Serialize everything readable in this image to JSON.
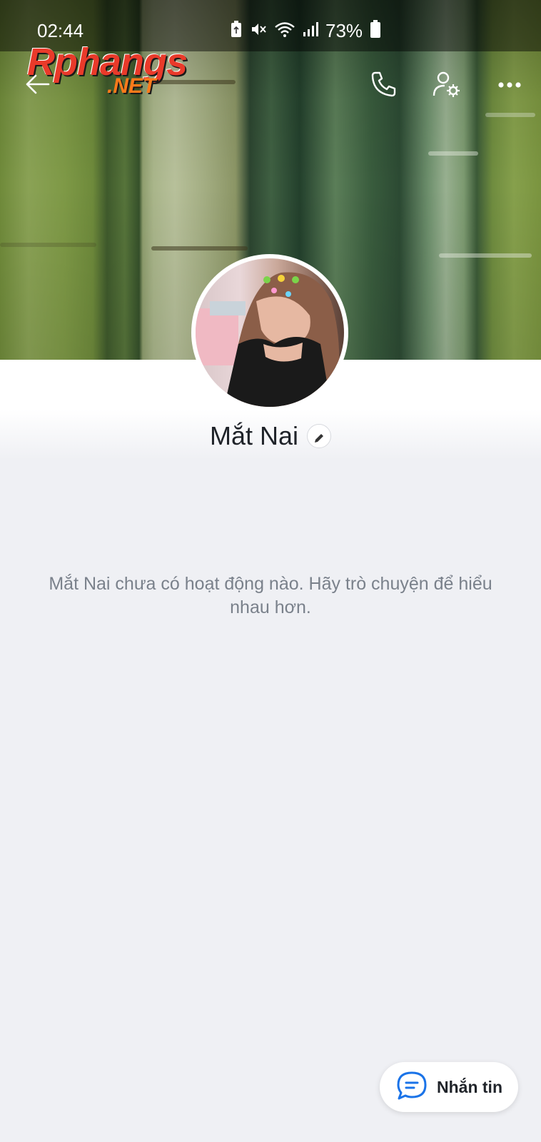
{
  "status_bar": {
    "time": "02:44",
    "battery_percent": "73%",
    "icons": [
      "battery-saver-icon",
      "mute-icon",
      "wifi-icon",
      "signal-icon",
      "battery-icon"
    ]
  },
  "watermark": {
    "line1": "Rphangs",
    "line2": ".NET"
  },
  "header": {
    "icons": [
      "back-arrow-icon",
      "phone-icon",
      "user-settings-icon",
      "more-icon"
    ]
  },
  "profile": {
    "name": "Mắt Nai",
    "empty_message": "Mắt Nai chưa có hoạt động nào. Hãy trò chuyện để hiểu nhau hơn."
  },
  "actions": {
    "message_label": "Nhắn tin"
  },
  "colors": {
    "background": "#eff0f4",
    "accent": "#1a73e8",
    "text_primary": "#1f2329",
    "text_secondary": "#7a818b"
  }
}
